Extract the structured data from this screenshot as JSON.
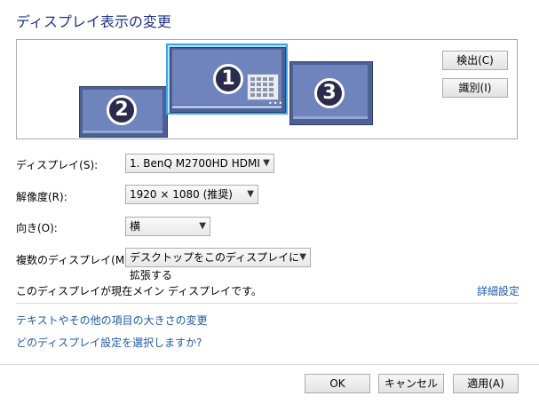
{
  "title": "ディスプレイ表示の変更",
  "monitors": [
    {
      "number": "1",
      "selected": true
    },
    {
      "number": "2",
      "selected": false
    },
    {
      "number": "3",
      "selected": false
    }
  ],
  "preview_buttons": {
    "detect": "検出(C)",
    "identify": "識別(I)"
  },
  "settings": {
    "display_label": "ディスプレイ(S):",
    "display_value": "1. BenQ M2700HD HDMI",
    "resolution_label": "解像度(R):",
    "resolution_value": "1920 × 1080 (推奨)",
    "orientation_label": "向き(O):",
    "orientation_value": "横",
    "multiple_label": "複数のディスプレイ(M):",
    "multiple_value": "デスクトップをこのディスプレイに拡張する"
  },
  "status_text": "このディスプレイが現在メイン ディスプレイです。",
  "advanced_link": "詳細設定",
  "links": {
    "text_size": "テキストやその他の項目の大きさの変更",
    "which_settings": "どのディスプレイ設定を選択しますか?"
  },
  "footer": {
    "ok": "OK",
    "cancel": "キャンセル",
    "apply": "適用(A)"
  },
  "colors": {
    "title": "#1e3287",
    "link": "#1e5aa8",
    "monitor": "#4d6195",
    "selection": "#36a8ee"
  }
}
